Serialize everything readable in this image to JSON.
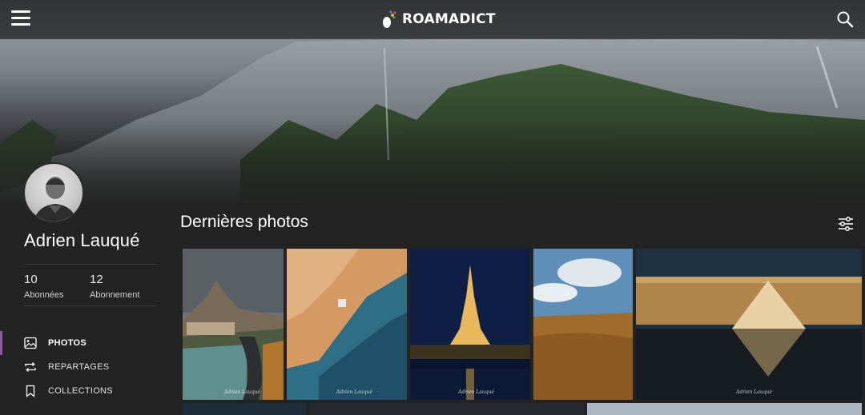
{
  "header": {
    "brand": "ROAMADICT",
    "menu_icon": "hamburger-icon",
    "search_icon": "search-icon"
  },
  "profile": {
    "name": "Adrien Lauqué",
    "followers": {
      "count": "10",
      "label": "Abonnées"
    },
    "following": {
      "count": "12",
      "label": "Abonnement"
    }
  },
  "nav": [
    {
      "label": "PHOTOS",
      "icon": "image-icon",
      "active": true
    },
    {
      "label": "REPARTAGES",
      "icon": "repost-icon",
      "active": false
    },
    {
      "label": "COLLECTIONS",
      "icon": "bookmark-icon",
      "active": false
    }
  ],
  "main": {
    "section_title": "Dernières photos",
    "filter_icon": "sliders-icon",
    "photos": [
      {
        "subject": "mountain-village-lake",
        "signature": "Adrien Lauqué"
      },
      {
        "subject": "aerial-sand-coast",
        "signature": "Adrien Lauqué"
      },
      {
        "subject": "eiffel-tower-night",
        "signature": "Adrien Lauqué"
      },
      {
        "subject": "dunes-grassland-sky",
        "signature": ""
      },
      {
        "subject": "louvre-pyramid-night",
        "signature": "Adrien Lauqué"
      }
    ]
  },
  "colors": {
    "accent": "#8e5aa6",
    "background": "#232323"
  }
}
